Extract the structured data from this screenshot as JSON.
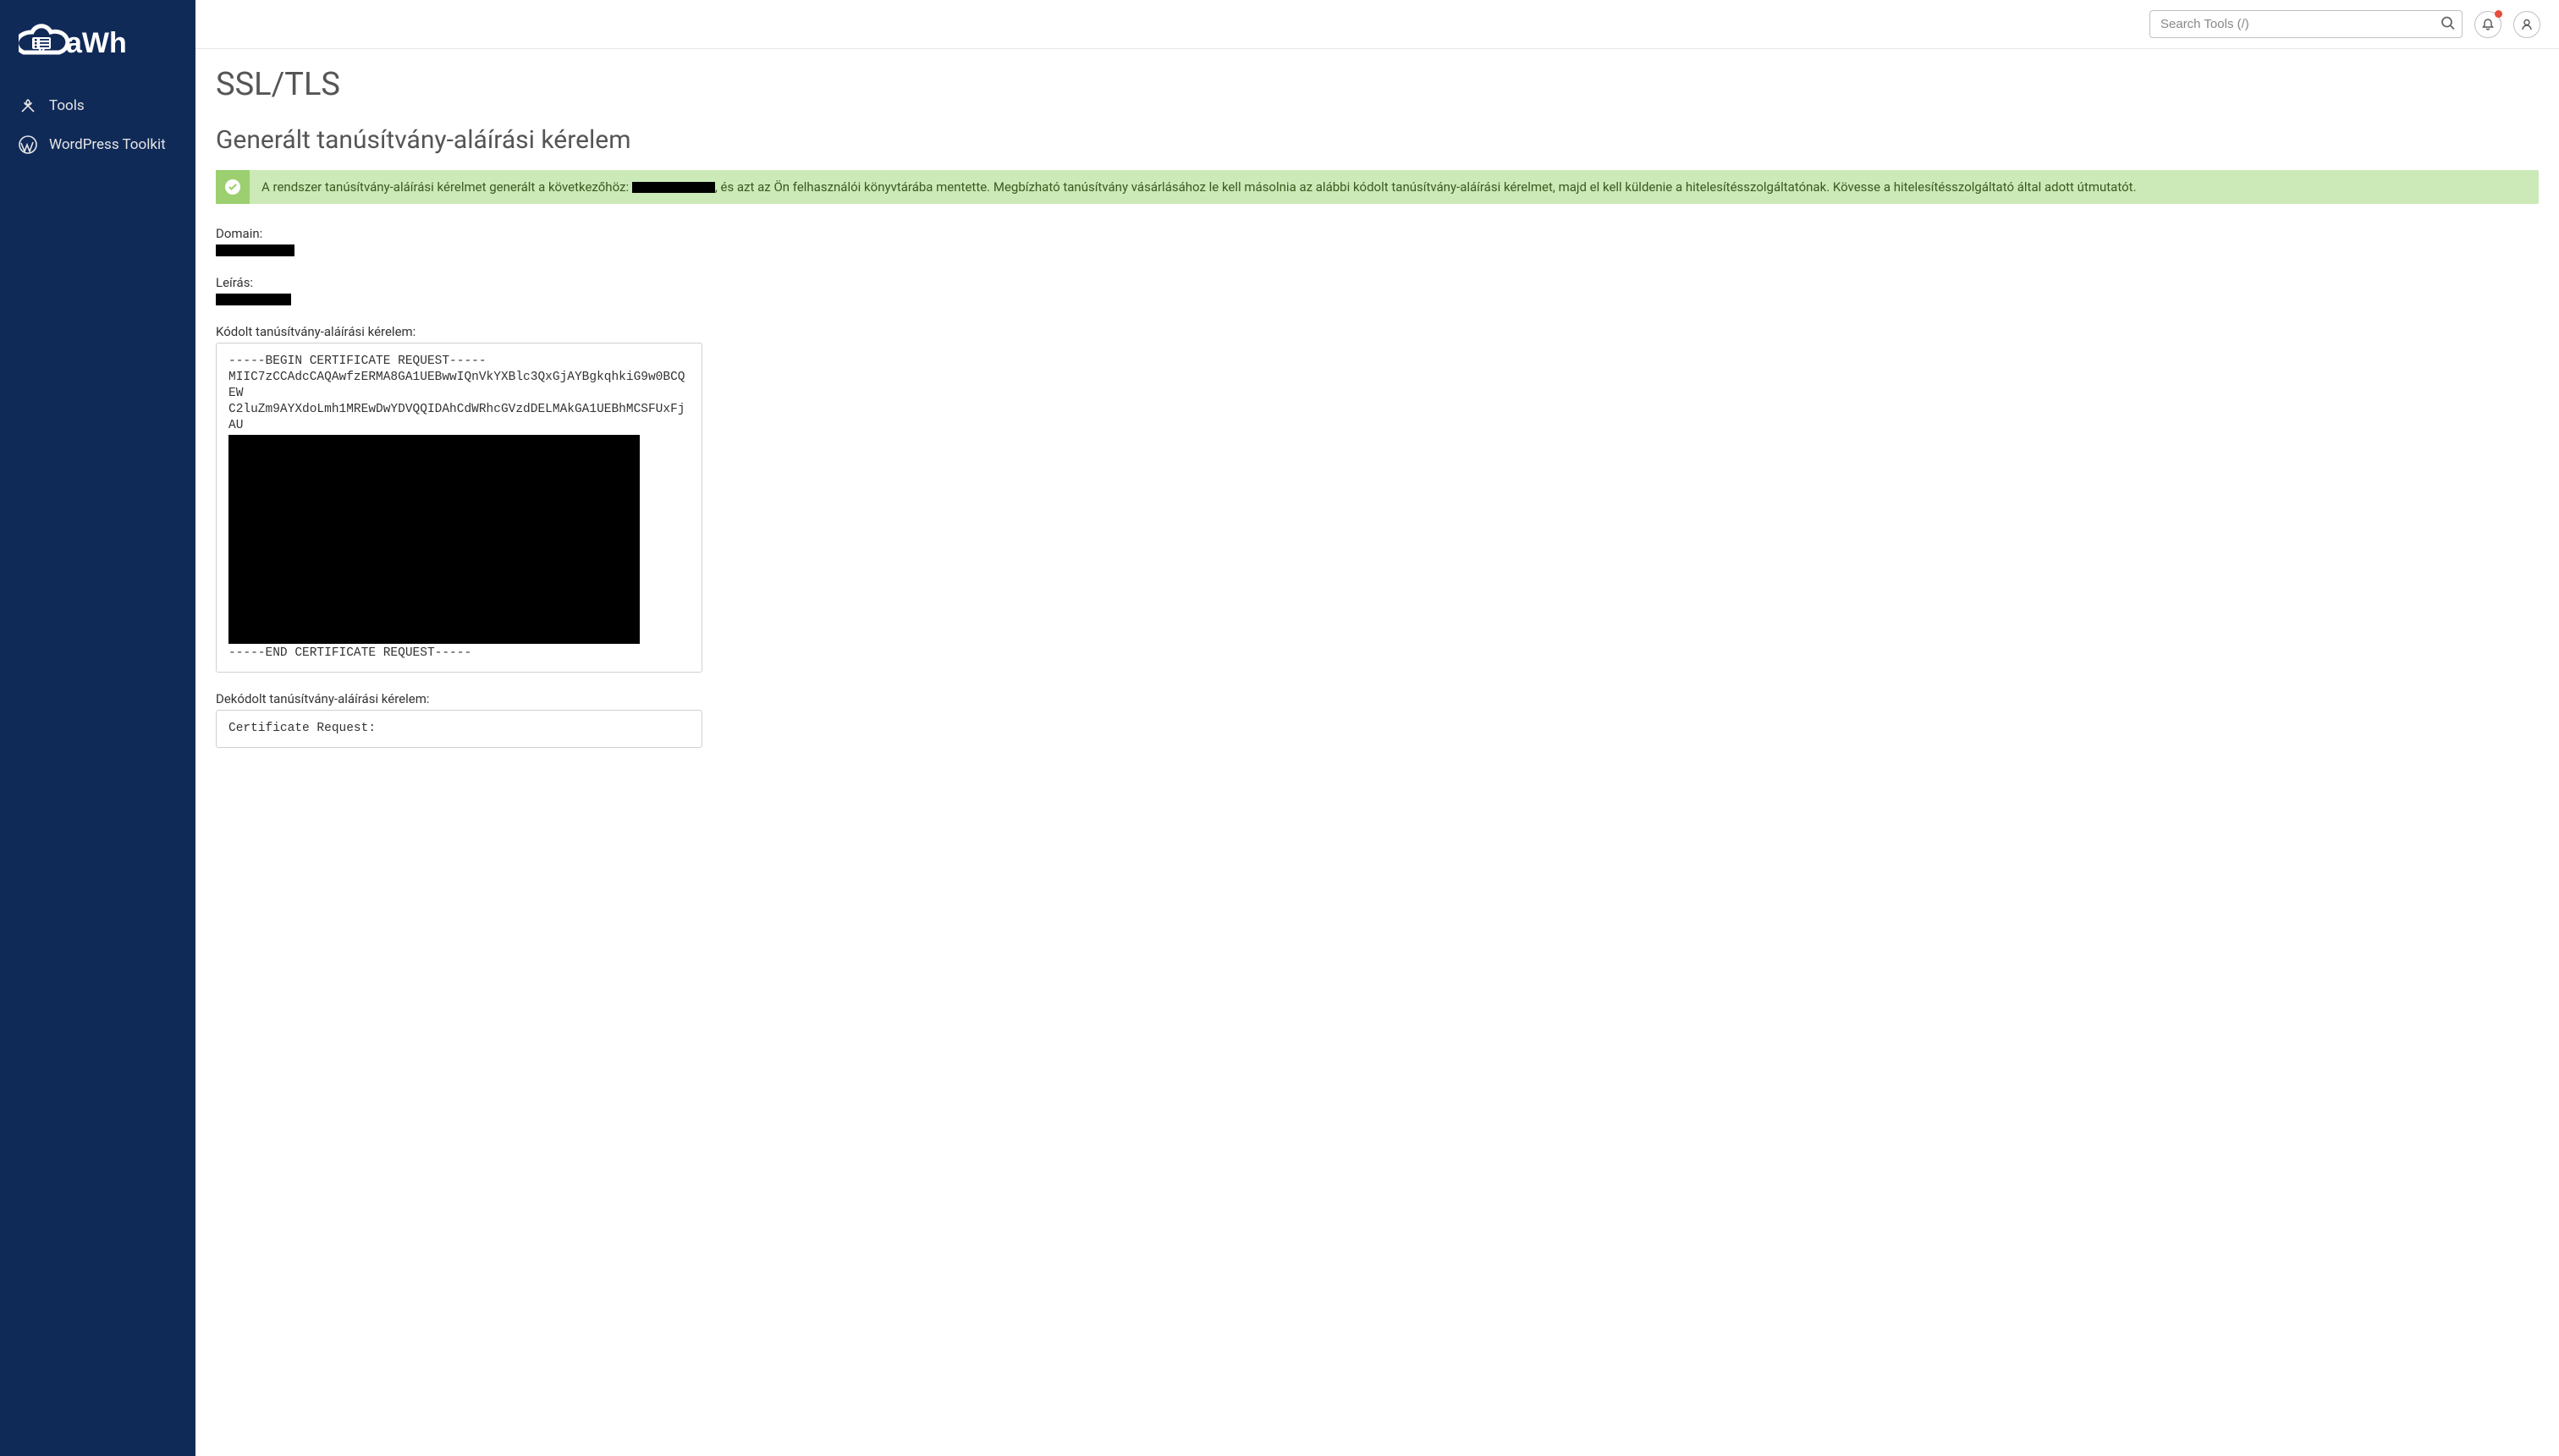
{
  "brand": "aWh",
  "sidebar": {
    "items": [
      {
        "label": "Tools"
      },
      {
        "label": "WordPress Toolkit"
      }
    ]
  },
  "search": {
    "placeholder": "Search Tools (/)"
  },
  "page": {
    "title": "SSL/TLS",
    "subtitle": "Generált tanúsítvány-aláírási kérelem"
  },
  "alert": {
    "pre": "A rendszer tanúsítvány-aláírási kérelmet generált a következőhöz: ",
    "post": ", és azt az Ön felhasználói könyvtárába mentette. Megbízható tanúsítvány vásárlásához le kell másolnia az alábbi kódolt tanúsítvány-aláírási kérelmet, majd el kell küldenie a hitelesítésszolgáltatónak. Kövesse a hitelesítésszolgáltató által adott útmutatót."
  },
  "fields": {
    "domain_label": "Domain:",
    "desc_label": "Leírás:",
    "encoded_label": "Kódolt tanúsítvány-aláírási kérelem:",
    "decoded_label": "Dekódolt tanúsítvány-aláírási kérelem:"
  },
  "csr": {
    "begin": "-----BEGIN CERTIFICATE REQUEST-----",
    "line1": "MIIC7zCCAdcCAQAwfzERMA8GA1UEBwwIQnVkYXBlc3QxGjAYBgkqhkiG9w0BCQEW",
    "line2": "C2luZm9AYXdoLmh1MREwDwYDVQQIDAhCdWRhcGVzdDELMAkGA1UEBhMCSFUxFjAU",
    "end": "-----END CERTIFICATE REQUEST-----"
  },
  "decoded": {
    "line0": "Certificate Request:"
  }
}
